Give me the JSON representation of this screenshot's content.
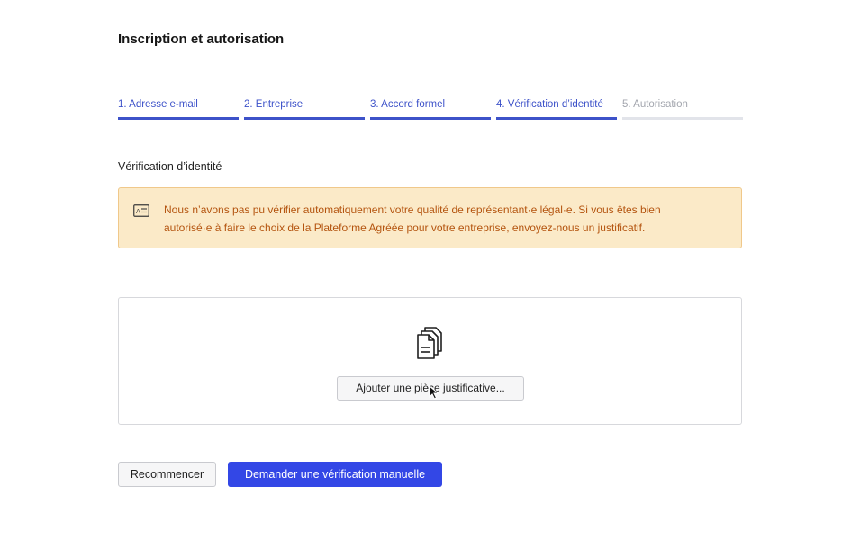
{
  "page": {
    "title": "Inscription et autorisation",
    "section_title": "Vérification d’identité"
  },
  "stepper": {
    "steps": [
      {
        "label": "1. Adresse e-mail",
        "state": "complete"
      },
      {
        "label": "2. Entreprise",
        "state": "complete"
      },
      {
        "label": "3. Accord formel",
        "state": "complete"
      },
      {
        "label": "4. Vérification d’identité",
        "state": "current"
      },
      {
        "label": "5. Autorisation",
        "state": "upcoming"
      }
    ]
  },
  "alert": {
    "icon": "id-card-icon",
    "line1": "Nous n’avons pas pu vérifier automatiquement votre qualité de représentant·e légal·e. Si vous êtes bien",
    "line2": "autorisé·e à faire le choix de la Plateforme Agréée pour votre entreprise, envoyez-nous un justificatif."
  },
  "upload": {
    "icon": "documents-icon",
    "button_label": "Ajouter une pièce justificative..."
  },
  "actions": {
    "restart_label": "Recommencer",
    "manual_verification_label": "Demander une vérification manuelle"
  },
  "colors": {
    "accent": "#3d52c9",
    "primary_button": "#3347e6",
    "alert_background": "#fbeac8",
    "alert_border": "#f0c88a",
    "alert_text": "#b4540f",
    "inactive_step": "#a3a6ae"
  }
}
